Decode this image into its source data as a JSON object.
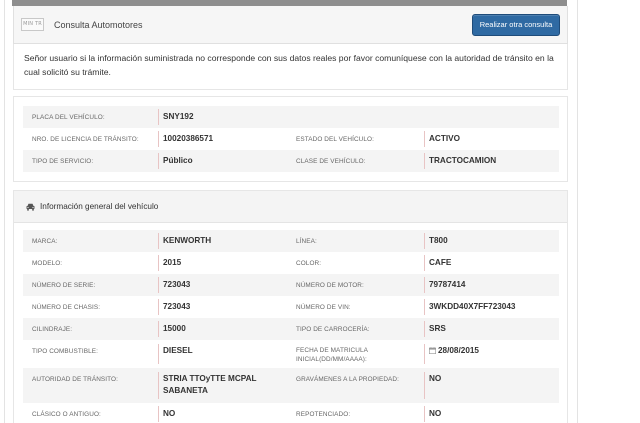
{
  "header": {
    "logo_text": "MIN TR",
    "title": "Consulta Automotores",
    "action_button": "Realizar otra consulta"
  },
  "notice": {
    "text": "Señor usuario si la información suministrada no corresponde con sus datos reales por favor comuníquese con la autoridad de tránsito en la cual solicitó su trámite."
  },
  "summary": {
    "rows": [
      {
        "l1": "PLACA DEL VEHÍCULO:",
        "v1": "SNY192",
        "l2": "",
        "v2": ""
      },
      {
        "l1": "NRO. DE LICENCIA DE TRÁNSITO:",
        "v1": "10020386571",
        "l2": "ESTADO DEL VEHÍCULO:",
        "v2": "ACTIVO"
      },
      {
        "l1": "TIPO DE SERVICIO:",
        "v1": "Público",
        "l2": "CLASE DE VEHÍCULO:",
        "v2": "TRACTOCAMION"
      }
    ]
  },
  "general": {
    "title": "Información general del vehículo",
    "rows": [
      {
        "l1": "MARCA:",
        "v1": "KENWORTH",
        "l2": "LÍNEA:",
        "v2": "T800"
      },
      {
        "l1": "MODELO:",
        "v1": "2015",
        "l2": "COLOR:",
        "v2": "CAFE"
      },
      {
        "l1": "NÚMERO DE SERIE:",
        "v1": "723043",
        "l2": "NÚMERO DE MOTOR:",
        "v2": "79787414"
      },
      {
        "l1": "NÚMERO DE CHASIS:",
        "v1": "723043",
        "l2": "NÚMERO DE VIN:",
        "v2": "3WKDD40X7FF723043"
      },
      {
        "l1": "CILINDRAJE:",
        "v1": "15000",
        "l2": "TIPO DE CARROCERÍA:",
        "v2": "SRS"
      },
      {
        "l1": "TIPO COMBUSTIBLE:",
        "v1": "DIESEL",
        "l2": "FECHA DE MATRICULA INICIAL(DD/MM/AAAA):",
        "v2": "28/08/2015"
      },
      {
        "l1": "AUTORIDAD DE TRÁNSITO:",
        "v1": "STRIA TTOyTTE MCPAL SABANETA",
        "l2": "GRAVÁMENES A LA PROPIEDAD:",
        "v2": "NO"
      },
      {
        "l1": "CLÁSICO O ANTIGUO:",
        "v1": "NO",
        "l2": "REPOTENCIADO:",
        "v2": "NO"
      }
    ]
  },
  "colors": {
    "primary_button": "#2f6aa3",
    "value_divider": "#e8c4c4",
    "stripe": "#f4f4f4"
  },
  "icons": {
    "panel": "car-icon",
    "date": "calendar-icon"
  }
}
